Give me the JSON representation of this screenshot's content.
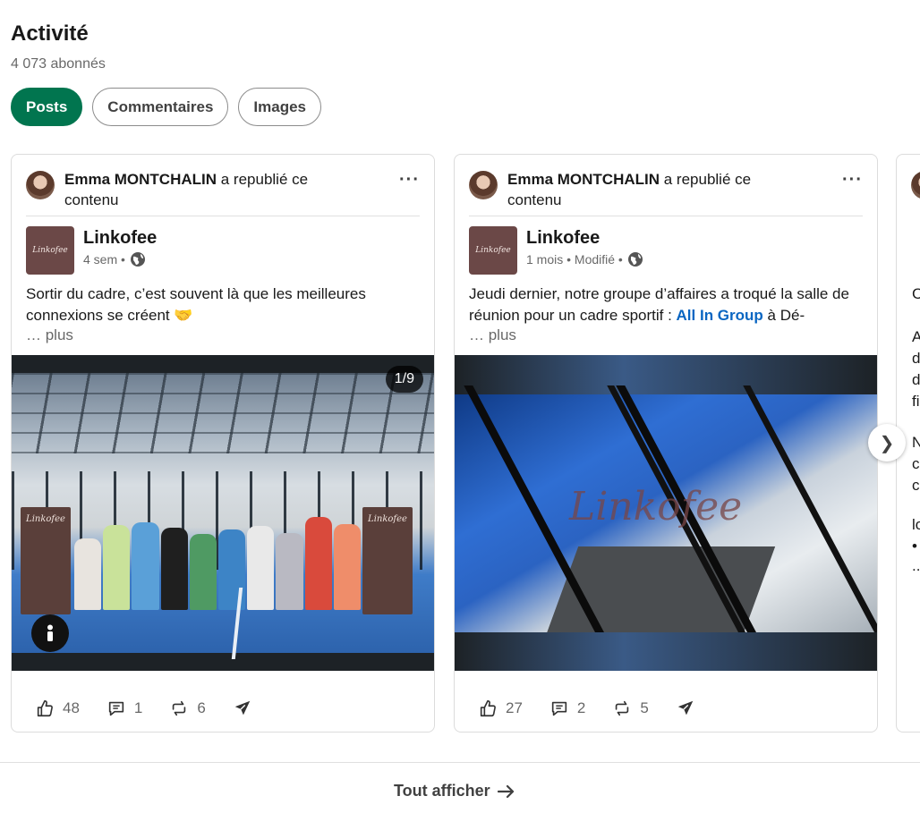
{
  "section": {
    "title": "Activité",
    "followers": "4 073 abonnés"
  },
  "tabs": [
    {
      "label": "Posts",
      "active": true
    },
    {
      "label": "Commentaires",
      "active": false
    },
    {
      "label": "Images",
      "active": false
    }
  ],
  "posts": [
    {
      "reposter": "Emma MONTCHALIN",
      "repost_action": "a republié ce contenu",
      "org_name": "Linkofee",
      "org_logo_text": "Linkofee",
      "meta": "4 sem •",
      "text": "Sortir du cadre, c’est souvent là que les meilleures connexions se créent 🤝",
      "text_link": "",
      "text_after": "",
      "see_more": "… plus",
      "media_counter": "1/9",
      "banner_text": "Linkofee",
      "reactions": "48",
      "comments": "1",
      "reposts": "6"
    },
    {
      "reposter": "Emma MONTCHALIN",
      "repost_action": "a republié ce contenu",
      "org_name": "Linkofee",
      "org_logo_text": "Linkofee",
      "meta": "1 mois • Modifié •",
      "text": "Jeudi dernier, notre groupe d’affaires a troqué la salle de réunion pour un cadre sportif : ",
      "text_link": "All In Group",
      "text_after": " à Dé-",
      "see_more": "… plus",
      "watermark": "Linkofee",
      "reactions": "27",
      "comments": "2",
      "reposts": "5"
    }
  ],
  "peek_card": {
    "lines": [
      "C",
      "A",
      "d",
      "d",
      "fi",
      "N",
      "c",
      "c",
      "lo",
      "•",
      ".."
    ]
  },
  "show_all": "Tout afficher",
  "colors": {
    "accent_green": "#01754f",
    "link_blue": "#0a66c2"
  }
}
